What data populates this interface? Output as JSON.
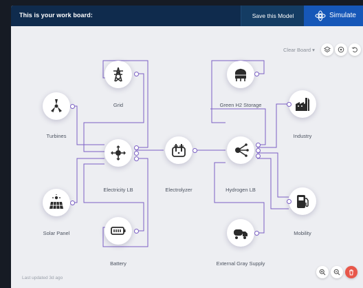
{
  "header": {
    "title": "This is your work board:",
    "save_label": "Save this Model",
    "simulate_label": "Simulate"
  },
  "toolbar": {
    "clear_board_label": "Clear Board ▾",
    "icons": [
      "layers-icon",
      "settings-icon",
      "undo-icon"
    ]
  },
  "nodes": {
    "turbines": {
      "label": "Turbines",
      "icon": "wind-turbine-icon"
    },
    "grid": {
      "label": "Grid",
      "icon": "power-pylon-icon"
    },
    "solar_panel": {
      "label": "Solar Panel",
      "icon": "solar-panel-icon"
    },
    "electricity_lb": {
      "label": "Electricity LB",
      "icon": "distribution-hub-icon"
    },
    "battery": {
      "label": "Battery",
      "icon": "battery-icon"
    },
    "electrolyzer": {
      "label": "Electrolyzer",
      "icon": "electrolyzer-icon"
    },
    "green_h2_storage": {
      "label": "Green H2 Storage",
      "icon": "storage-tank-icon"
    },
    "hydrogen_lb": {
      "label": "Hydrogen LB",
      "icon": "hydrogen-hub-icon"
    },
    "external_gray_supply": {
      "label": "External Gray Supply",
      "icon": "tanker-truck-icon"
    },
    "industry": {
      "label": "Industry",
      "icon": "factory-icon"
    },
    "mobility": {
      "label": "Mobility",
      "icon": "fuel-pump-icon"
    }
  },
  "footer": {
    "last_updated": "Last updated 3d ago",
    "zoom_icons": [
      "zoom-in-icon",
      "zoom-out-icon"
    ],
    "delete_icon": "trash-icon"
  },
  "colors": {
    "header_bg": "#0f2b4d",
    "simulate_bg": "#1657b8",
    "connector": "#7a5fc4",
    "delete_bg": "#e8574a"
  }
}
